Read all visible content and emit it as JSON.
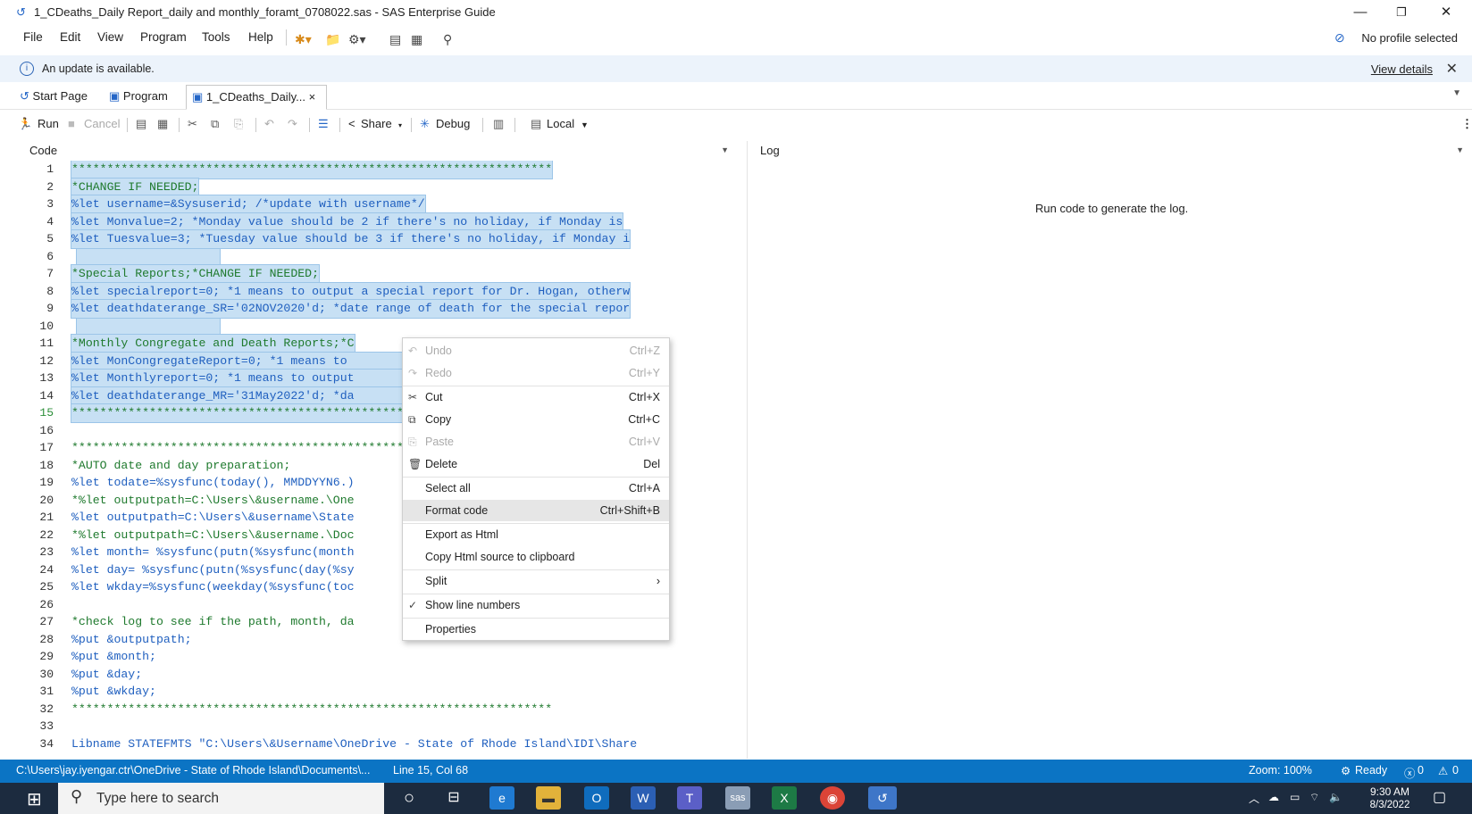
{
  "window": {
    "title": "1_CDeaths_Daily Report_daily and monthly_foramt_0708022.sas - SAS Enterprise Guide",
    "controls": [
      "—",
      "❐",
      "✕"
    ]
  },
  "menubar": {
    "items": [
      "File",
      "Edit",
      "View",
      "Program",
      "Tools",
      "Help"
    ],
    "profile": "No profile selected"
  },
  "banner": {
    "message": "An update is available.",
    "link": "View details",
    "close": "✕"
  },
  "tabs": [
    {
      "label": "Start Page",
      "close": ""
    },
    {
      "label": "Program",
      "close": ""
    },
    {
      "label": "1_CDeaths_Daily...",
      "close": "×"
    }
  ],
  "toolbar": {
    "run": "Run",
    "cancel": "Cancel",
    "share": "Share",
    "debug": "Debug",
    "server": "Local"
  },
  "panes": {
    "code_label": "Code",
    "log_label": "Log",
    "log_message": "Run code to generate the log."
  },
  "code_lines": [
    {
      "n": "1",
      "text": "********************************************************************"
    },
    {
      "n": "2",
      "text": "*CHANGE IF NEEDED;"
    },
    {
      "n": "3",
      "text": "%let username=&Sysuserid; /*update with username*/"
    },
    {
      "n": "4",
      "text": "%let Monvalue=2; *Monday value should be 2 if there's no holiday, if Monday is"
    },
    {
      "n": "5",
      "text": "%let Tuesvalue=3; *Tuesday value should be 3 if there's no holiday, if Monday i"
    },
    {
      "n": "6",
      "text": ""
    },
    {
      "n": "7",
      "text": "*Special Reports;*CHANGE IF NEEDED;"
    },
    {
      "n": "8",
      "text": "%let specialreport=0; *1 means to output a special report for Dr. Hogan, otherw"
    },
    {
      "n": "9",
      "text": "%let deathdaterange_SR='02NOV2020'd; *date range of death for the special repor"
    },
    {
      "n": "10",
      "text": ""
    },
    {
      "n": "11",
      "text": "*Monthly Congregate and Death Reports;*C"
    },
    {
      "n": "12",
      "text": "%let MonCongregateReport=0; *1 means to                           ise no m"
    },
    {
      "n": "13",
      "text": "%let Monthlyreport=0; *1 means to output                            monthly"
    },
    {
      "n": "14",
      "text": "%let deathdaterange_MR='31May2022'd; *da                           ly repor"
    },
    {
      "n": "15",
      "text": "********************************************************************"
    },
    {
      "n": "16",
      "text": ""
    },
    {
      "n": "17",
      "text": "********************************************************************"
    },
    {
      "n": "18",
      "text": "*AUTO date and day preparation;"
    },
    {
      "n": "19",
      "text": "%let todate=%sysfunc(today(), MMDDYYN6.)"
    },
    {
      "n": "20",
      "text": "*%let outputpath=C:\\Users\\&username.\\One                           nalytics"
    },
    {
      "n": "21",
      "text": "%let outputpath=C:\\Users\\&username\\State                           am - Sur"
    },
    {
      "n": "22",
      "text": "*%let outputpath=C:\\Users\\&username.\\Doc"
    },
    {
      "n": "23",
      "text": "%let month= %sysfunc(putn(%sysfunc(month"
    },
    {
      "n": "24",
      "text": "%let day= %sysfunc(putn(%sysfunc(day(%sy"
    },
    {
      "n": "25",
      "text": "%let wkday=%sysfunc(weekday(%sysfunc(toc                           day, wkd"
    },
    {
      "n": "26",
      "text": ""
    },
    {
      "n": "27",
      "text": "*check log to see if the path, month, da                           ;"
    },
    {
      "n": "28",
      "text": "%put &outputpath;"
    },
    {
      "n": "29",
      "text": "%put &month;"
    },
    {
      "n": "30",
      "text": "%put &day;"
    },
    {
      "n": "31",
      "text": "%put &wkday;"
    },
    {
      "n": "32",
      "text": "********************************************************************"
    },
    {
      "n": "33",
      "text": ""
    },
    {
      "n": "34",
      "text": "Libname STATEFMTS \"C:\\Users\\&Username\\OneDrive - State of Rhode Island\\IDI\\Share"
    }
  ],
  "context_menu": [
    {
      "label": "Undo",
      "shortcut": "Ctrl+Z",
      "icon": "undo-icon",
      "glyph": "↶"
    },
    {
      "label": "Redo",
      "shortcut": "Ctrl+Y",
      "icon": "redo-icon",
      "glyph": "↷"
    },
    {
      "label": "Cut",
      "shortcut": "Ctrl+X",
      "icon": "scissors-icon",
      "glyph": "✂"
    },
    {
      "label": "Copy",
      "shortcut": "Ctrl+C",
      "icon": "copy-icon",
      "glyph": "⧉"
    },
    {
      "label": "Paste",
      "shortcut": "Ctrl+V",
      "icon": "paste-icon",
      "glyph": "⎘"
    },
    {
      "label": "Delete",
      "shortcut": "Del",
      "icon": "trash-icon",
      "glyph": "🗑"
    },
    {
      "label": "Select all",
      "shortcut": "Ctrl+A",
      "icon": "",
      "glyph": ""
    },
    {
      "label": "Format code",
      "shortcut": "Ctrl+Shift+B",
      "icon": "",
      "glyph": ""
    },
    {
      "label": "Export as Html",
      "shortcut": "",
      "icon": "",
      "glyph": ""
    },
    {
      "label": "Copy Html source to clipboard",
      "shortcut": "",
      "icon": "",
      "glyph": ""
    },
    {
      "label": "Split",
      "shortcut": "›",
      "icon": "",
      "glyph": ""
    },
    {
      "label": "Show line numbers",
      "shortcut": "",
      "icon": "check-icon",
      "glyph": "✓"
    },
    {
      "label": "Properties",
      "shortcut": "",
      "icon": "",
      "glyph": ""
    }
  ],
  "statusbar": {
    "path": "C:\\Users\\jay.iyengar.ctr\\OneDrive - State of Rhode Island\\Documents\\...",
    "position": "Line 15, Col 68",
    "zoom": "Zoom: 100%",
    "state": "Ready",
    "errors": "0",
    "warnings": "0"
  },
  "taskbar": {
    "search_placeholder": "Type here to search",
    "time": "9:30 AM",
    "date": "8/3/2022"
  },
  "colors": {
    "status_blue": "#0b74c4",
    "selection": "#c7e0f4",
    "comment_green": "#1f7a2e",
    "keyword_blue": "#1f5fbf"
  }
}
